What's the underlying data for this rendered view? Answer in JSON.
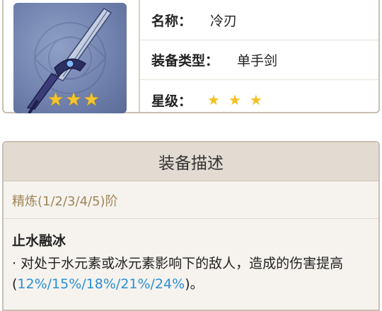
{
  "weapon": {
    "name_label": "名称：",
    "name_value": "冷刃",
    "type_label": "装备类型：",
    "type_value": "单手剑",
    "rarity_label": "星级：",
    "rarity_stars": [
      "★",
      "★",
      "★"
    ],
    "thumb_stars": [
      "★",
      "★",
      "★"
    ]
  },
  "description": {
    "header": "装备描述",
    "refinement": "精炼(1/2/3/4/5)阶",
    "passive_name": "止水融冰",
    "passive_text_prefix": "· 对处于水元素或冰元素影响下的敌人，造成的伤害提高(",
    "passive_values": "12%/15%/18%/21%/24%",
    "passive_text_suffix": ")。"
  },
  "colors": {
    "star": "#f4c122",
    "highlight": "#2a8fd4",
    "refine_text": "#a0865a"
  },
  "icons": {
    "weapon": "sword-icon",
    "star": "star-icon"
  }
}
